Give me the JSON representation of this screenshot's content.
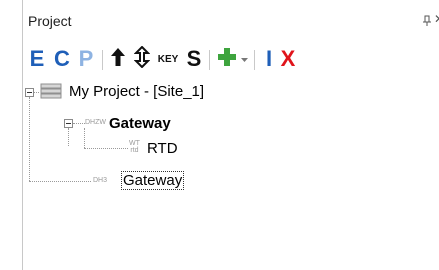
{
  "panel": {
    "title": "Project"
  },
  "toolbar": {
    "e_label": "E",
    "c_label": "C",
    "p_label": "P",
    "key_label": "KEY",
    "s_label": "S",
    "i_label": "I",
    "x_label": "X",
    "colors": {
      "blue": "#1f5fb8",
      "light_blue": "#8eb3e2",
      "black": "#111111",
      "green": "#3ea43e",
      "red": "#e0141b"
    }
  },
  "tree": {
    "root": {
      "label": "My Project - [Site_1]"
    },
    "gateway_node": {
      "tag": "DHZW",
      "label": "Gateway"
    },
    "rtd_node": {
      "tag_top": "WT",
      "tag_bottom": "rtd",
      "label": "RTD"
    },
    "gateway2_node": {
      "tag": "DH3",
      "label": "Gateway"
    }
  }
}
